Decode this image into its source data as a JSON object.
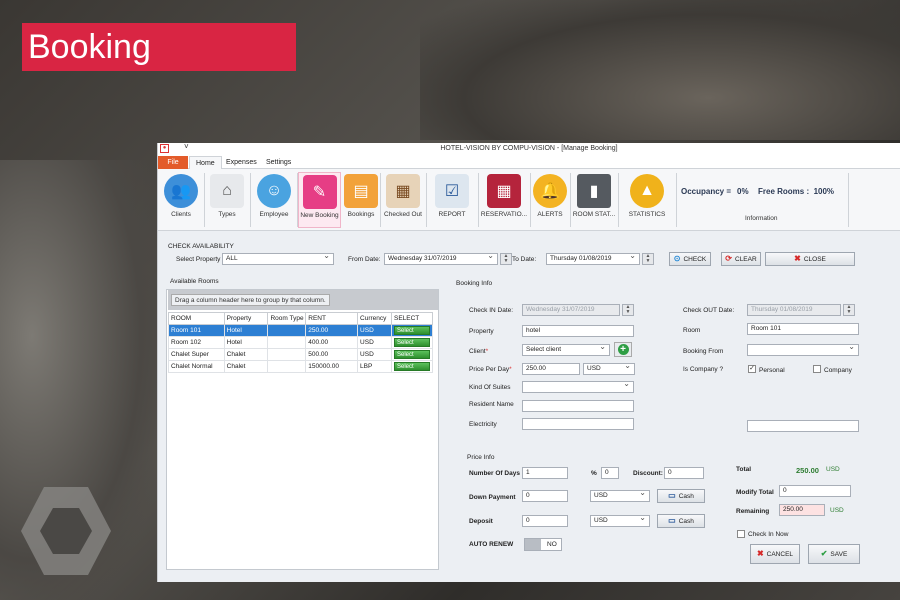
{
  "hero": {
    "title": "Booking"
  },
  "window": {
    "title": "HOTEL-VISION BY COMPU-VISION - [Manage Booking]"
  },
  "menu_tabs": [
    "File",
    "Home",
    "Expenses",
    "Settings"
  ],
  "ribbon": {
    "buttons": [
      "Clients",
      "Types",
      "Employee",
      "New Booking",
      "Bookings",
      "Checked Out",
      "REPORT",
      "RESERVATIO...",
      "ALERTS",
      "ROOM STAT...",
      "STATISTICS"
    ],
    "occupancy_label": "Occupancy =",
    "occupancy_value": "0%",
    "free_rooms_label": "Free Rooms :",
    "free_rooms_value": "100%",
    "information_label": "Information"
  },
  "availability": {
    "section_label": "CHECK AVAILABILITY",
    "select_property_label": "Select Property",
    "property_value": "ALL",
    "from_date_label": "From Date:",
    "from_date_value": "Wednesday 31/07/2019",
    "to_date_label": "To Date:",
    "to_date_value": "Thursday 01/08/2019",
    "check_btn": "CHECK",
    "clear_btn": "CLEAR",
    "close_btn": "CLOSE"
  },
  "available_rooms": {
    "label": "Available Rooms",
    "group_hint": "Drag a column header here to group by that column.",
    "columns": [
      "ROOM",
      "Property",
      "Room Type",
      "RENT",
      "Currency",
      "SELECT"
    ],
    "rows": [
      {
        "room": "Room 101",
        "property": "Hotel",
        "type": "",
        "rent": "250.00",
        "currency": "USD",
        "select": "Select"
      },
      {
        "room": "Room 102",
        "property": "Hotel",
        "type": "",
        "rent": "400.00",
        "currency": "USD",
        "select": "Select"
      },
      {
        "room": "Chalet Super",
        "property": "Chalet",
        "type": "",
        "rent": "500.00",
        "currency": "USD",
        "select": "Select"
      },
      {
        "room": "Chalet Normal",
        "property": "Chalet",
        "type": "",
        "rent": "150000.00",
        "currency": "LBP",
        "select": "Select"
      }
    ]
  },
  "booking_info": {
    "label": "Booking Info",
    "check_in_label": "Check IN Date:",
    "check_in_value": "Wednesday 31/07/2019",
    "check_out_label": "Check OUT Date:",
    "check_out_value": "Thursday 01/08/2019",
    "property_label": "Property",
    "property_value": "hotel",
    "room_label": "Room",
    "room_value": "Room 101",
    "client_label": "Client",
    "client_value": "Select client",
    "booking_from_label": "Booking From",
    "price_label": "Price Per Day",
    "price_value": "250.00",
    "price_currency": "USD",
    "is_company_label": "Is Company ?",
    "personal_label": "Personal",
    "company_label": "Company",
    "kind_label": "Kind Of Suites",
    "resident_label": "Resident Name",
    "electricity_label": "Electricity"
  },
  "price_info": {
    "label": "Price Info",
    "days_label": "Number Of Days",
    "days_value": "1",
    "percent_label": "%",
    "percent_value": "0",
    "discount_label": "Discount:",
    "discount_value": "0",
    "total_label": "Total",
    "total_value": "250.00",
    "total_currency": "USD",
    "down_label": "Down Payment",
    "down_value": "0",
    "down_currency": "USD",
    "cash_label": "Cash",
    "modify_label": "Modify Total",
    "modify_value": "0",
    "deposit_label": "Deposit",
    "deposit_value": "0",
    "deposit_currency": "USD",
    "remaining_label": "Remaining",
    "remaining_value": "250.00",
    "remaining_currency": "USD",
    "auto_renew_label": "AUTO RENEW",
    "auto_renew_value": "NO",
    "check_in_now_label": "Check In Now",
    "cancel_btn": "CANCEL",
    "save_btn": "SAVE"
  },
  "colors": {
    "accent": "#d92543",
    "file_tab": "#e35b2a",
    "selection": "#2d7fd3",
    "total_green": "#2e7d32"
  }
}
